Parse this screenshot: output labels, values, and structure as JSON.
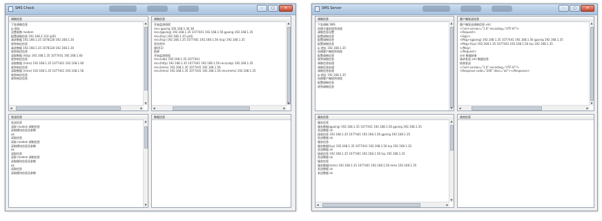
{
  "left_window": {
    "title": "SMS Check",
    "buttons": {
      "minimize": "–",
      "maximize": "□",
      "close": "✕"
    },
    "top_left": {
      "label": "调制信息",
      "lines": [
        "下发调制信息",
        "ip 地址",
        "设置参数 modem",
        "配置调制信息 192.168.2.110 ip(6)",
        "请求数据 192.168.1.35 1078128 192.168.1.30",
        "收到响应信息",
        "请求数据 192.168.1.35 1078128 192.168.1.30",
        "收到响应信息",
        "读取数据 (http) 192.168.1.35 1077441 192.168.1.60",
        "收到响应信息",
        "读取数据 (mms) 192.168.1.35 1077441 192.168.1.60",
        "收到响应信息",
        "读取数据 (mms) 192.168.1.35 1077441 192.168.1.56",
        "收到响应信息",
        "收到响应信息"
      ]
    },
    "top_right": {
      "label": "调制信息",
      "lines": [
        "开始监测线程",
        "recv gpoing 192.168.1.34 38",
        "recv(gpoing) 192.168.1.35 1077441 192.168.1.56 gpoing 192.168.1.35",
        "recv(tcp) 192.168.1.35 ip(6)",
        "recv(tcp) 192.168.1.35 1077441 192.168.1.56 (tcp) 192.168.1.35",
        "发包完毕",
        "超时(3)",
        "结果",
        "开始监测线程",
        "recv(udp) 192.168.1.35 1077441",
        "recv(http) 192.168.1.35 1077441 192.168.1.56 recv(udp) 192.168.1.35",
        "recv(mms) 192.168.1.35 1077441 192.168.1.56",
        "recv(mms) 192.168.1.35 1077441 192.168.1.56 recv(mms) 192.168.1.35"
      ]
    },
    "bottom_left": {
      "label": "发送信息",
      "lines": [
        "发送信息",
        "读取 modem 调制信息",
        "读取模块信息及参数",
        "ok",
        "读取信息",
        "读取 modem 调制信息",
        "读取模块信息及参数",
        "ok",
        "读取信息",
        "读取 modem 调制信息",
        "读取模块信息及参数",
        "ok",
        "读取信息",
        "读取模块信息及参数"
      ]
    },
    "bottom_right": {
      "label": "数据信息",
      "lines": []
    }
  },
  "right_window": {
    "title": "SMS Server",
    "buttons": {
      "minimize": "–",
      "maximize": "□",
      "close": "✕"
    },
    "top_left": {
      "label": "调制信息",
      "lines": [
        "下发调制 SMS",
        "创建主服务程序进程",
        "调制信息设置",
        "配置调制信息",
        "配置调制信息",
        "配置调制信息",
        "ip 地址 192.168.1.35",
        "创建客户端程序线程",
        "配置调制信息",
        "收到调制信息",
        "调制信息处理",
        "调制信息处理",
        "调制信息处理",
        "ip 地址 192.168.1.35",
        "创建客户端程序线程",
        "配置调制信息",
        "收到调制信息"
      ]
    },
    "top_right": {
      "label": "客户端发送信息",
      "lines": [
        "客户端发送调制信息 xml",
        "<?xml version=\"1.0\" encoding=\"UTF-8\"?>",
        "<Request>",
        "<Sign>",
        "<Msg>(gpoing) 192.168.1.35 1077441 192.168.1.56 gpoing 192.168.1.35",
        "<Msg>(tcp) 192.168.1.35 1077441 192.168.1.56 tcp 192.168.1.35",
        "</Msg>",
        "</Request>",
        "xml 数据结束",
        "请求发送 xml 数据信息",
        "结束发送",
        "<?xml version=\"1.0\" encoding=\"UTF-8\"?>",
        "<Response code=\"200\" desc=\"ok\"></Response>"
      ]
    },
    "bottom_left": {
      "label": "服务信息",
      "lines": [
        "服务信息",
        "服务数据(gpoing) 192.168.1.35 1077441 192.168.1.56 gpoing 192.168.1.35",
        "发送数据 ok",
        "接收信息 192.168.1.35 1077441 192.168.1.56 gpoing 192.168.1.35",
        "发送数据 ok",
        "服务信息",
        "服务数据(tcp) 192.168.1.35 1077441 192.168.1.56 tcp 192.168.1.35",
        "发送数据 ok",
        "接收信息 192.168.1.35 1077441 192.168.1.56 tcp 192.168.1.35",
        "发送数据 ok",
        "服务信息",
        "服务数据(mms) 192.168.1.35 1077441 192.168.1.56 mms 192.168.1.35",
        "发送数据 ok",
        "发送数据 ok"
      ]
    },
    "bottom_right": {
      "label": "其他信息",
      "lines": []
    }
  }
}
